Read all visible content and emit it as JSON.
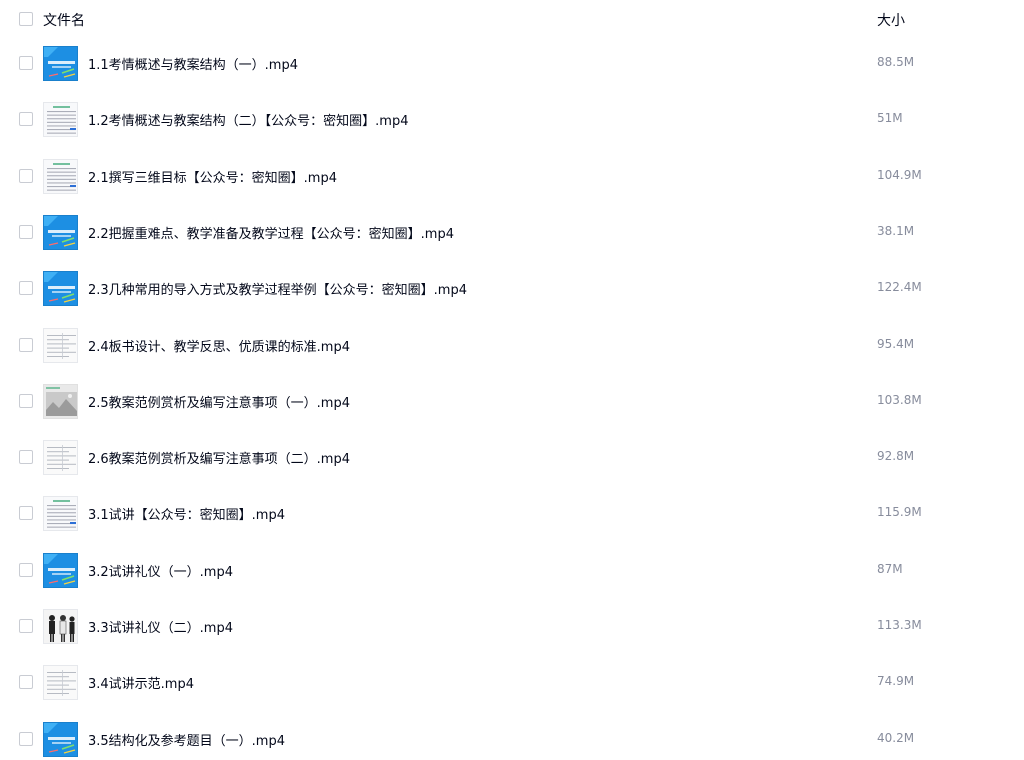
{
  "header": {
    "name_label": "文件名",
    "size_label": "大小"
  },
  "files": [
    {
      "name": "1.1考情概述与教案结构（一）.mp4",
      "size": "88.5M",
      "thumb": "blue-slide"
    },
    {
      "name": "1.2考情概述与教案结构（二）【公众号：密知圈】.mp4",
      "size": "51M",
      "thumb": "doc-table"
    },
    {
      "name": "2.1撰写三维目标【公众号：密知圈】.mp4",
      "size": "104.9M",
      "thumb": "doc-table"
    },
    {
      "name": "2.2把握重难点、教学准备及教学过程【公众号：密知圈】.mp4",
      "size": "38.1M",
      "thumb": "blue-slide"
    },
    {
      "name": "2.3几种常用的导入方式及教学过程举例【公众号：密知圈】.mp4",
      "size": "122.4M",
      "thumb": "blue-slide"
    },
    {
      "name": "2.4板书设计、教学反思、优质课的标准.mp4",
      "size": "95.4M",
      "thumb": "doc-lines"
    },
    {
      "name": "2.5教案范例赏析及编写注意事项（一）.mp4",
      "size": "103.8M",
      "thumb": "gray-image"
    },
    {
      "name": "2.6教案范例赏析及编写注意事项（二）.mp4",
      "size": "92.8M",
      "thumb": "doc-lines"
    },
    {
      "name": "3.1试讲【公众号：密知圈】.mp4",
      "size": "115.9M",
      "thumb": "doc-table"
    },
    {
      "name": "3.2试讲礼仪（一）.mp4",
      "size": "87M",
      "thumb": "blue-slide"
    },
    {
      "name": "3.3试讲礼仪（二）.mp4",
      "size": "113.3M",
      "thumb": "people"
    },
    {
      "name": "3.4试讲示范.mp4",
      "size": "74.9M",
      "thumb": "doc-lines"
    },
    {
      "name": "3.5结构化及参考题目（一）.mp4",
      "size": "40.2M",
      "thumb": "blue-slide"
    }
  ]
}
